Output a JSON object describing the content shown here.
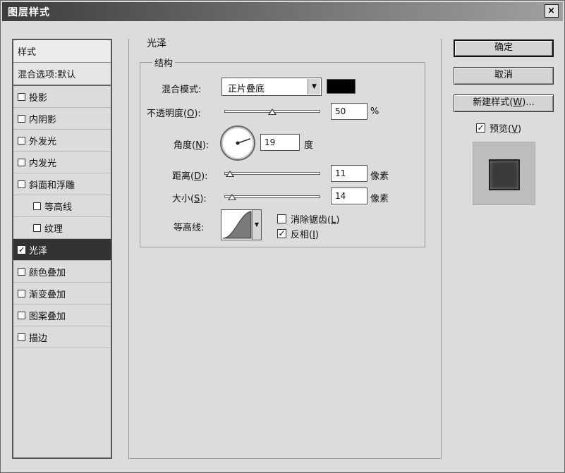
{
  "window": {
    "title": "图层样式",
    "close_glyph": "×"
  },
  "style_list": {
    "header": "样式",
    "blend_options": "混合选项:默认",
    "items": [
      {
        "label": "投影",
        "checked": false,
        "sub": false,
        "selected": false
      },
      {
        "label": "内阴影",
        "checked": false,
        "sub": false,
        "selected": false
      },
      {
        "label": "外发光",
        "checked": false,
        "sub": false,
        "selected": false
      },
      {
        "label": "内发光",
        "checked": false,
        "sub": false,
        "selected": false
      },
      {
        "label": "斜面和浮雕",
        "checked": false,
        "sub": false,
        "selected": false
      },
      {
        "label": "等高线",
        "checked": false,
        "sub": true,
        "selected": false
      },
      {
        "label": "纹理",
        "checked": false,
        "sub": true,
        "selected": false
      },
      {
        "label": "光泽",
        "checked": true,
        "sub": false,
        "selected": true
      },
      {
        "label": "颜色叠加",
        "checked": false,
        "sub": false,
        "selected": false
      },
      {
        "label": "渐变叠加",
        "checked": false,
        "sub": false,
        "selected": false
      },
      {
        "label": "图案叠加",
        "checked": false,
        "sub": false,
        "selected": false
      },
      {
        "label": "描边",
        "checked": false,
        "sub": false,
        "selected": false
      }
    ]
  },
  "panel": {
    "section_title": "光泽",
    "group_title": "结构",
    "blend_mode": {
      "label": "混合模式:",
      "value": "正片叠底",
      "color": "#000000"
    },
    "opacity": {
      "label": "不透明度(O):",
      "value": "50",
      "unit": "%",
      "slider": 0.5
    },
    "angle": {
      "label": "角度(N):",
      "value": "19",
      "unit": "度",
      "degrees": 19
    },
    "distance": {
      "label": "距离(D):",
      "value": "11",
      "unit": "像素",
      "slider": 0.06
    },
    "size": {
      "label": "大小(S):",
      "value": "14",
      "unit": "像素",
      "slider": 0.08
    },
    "contour": {
      "label": "等高线:"
    },
    "anti_alias": {
      "label": "消除锯齿(L)",
      "checked": false
    },
    "invert": {
      "label": "反相(I)",
      "checked": true
    }
  },
  "buttons": {
    "ok": "确定",
    "cancel": "取消",
    "new_style": "新建样式(W)...",
    "preview_label": "预览(V)",
    "preview_checked": true
  }
}
